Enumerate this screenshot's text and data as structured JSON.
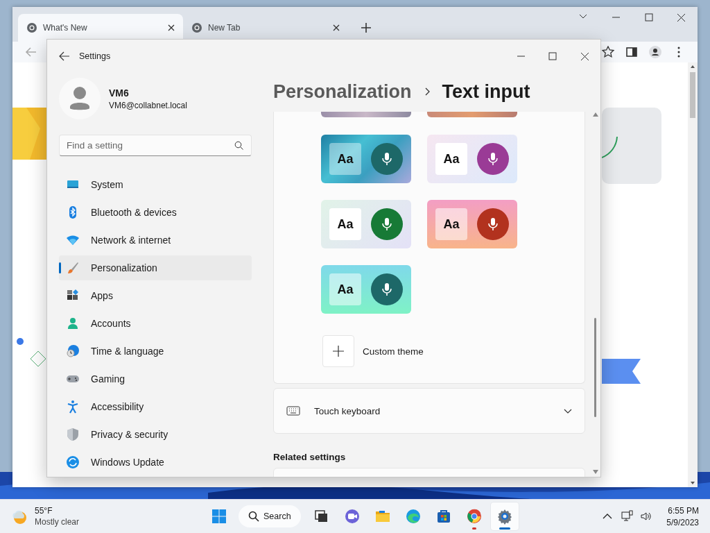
{
  "browser": {
    "tabs": [
      {
        "title": "What's New",
        "selected": true
      },
      {
        "title": "New Tab",
        "selected": false
      }
    ]
  },
  "settings": {
    "window_title": "Settings",
    "account": {
      "name": "VM6",
      "email": "VM6@collabnet.local"
    },
    "search": {
      "placeholder": "Find a setting"
    },
    "nav": [
      {
        "label": "System",
        "selected": false
      },
      {
        "label": "Bluetooth & devices",
        "selected": false
      },
      {
        "label": "Network & internet",
        "selected": false
      },
      {
        "label": "Personalization",
        "selected": true
      },
      {
        "label": "Apps",
        "selected": false
      },
      {
        "label": "Accounts",
        "selected": false
      },
      {
        "label": "Time & language",
        "selected": false
      },
      {
        "label": "Gaming",
        "selected": false
      },
      {
        "label": "Accessibility",
        "selected": false
      },
      {
        "label": "Privacy & security",
        "selected": false
      },
      {
        "label": "Windows Update",
        "selected": false
      }
    ],
    "breadcrumb": {
      "parent": "Personalization",
      "current": "Text input"
    },
    "themes": [
      {
        "text": "Aa",
        "color": "#1d6868"
      },
      {
        "text": "Aa",
        "color": "#9a3b96"
      },
      {
        "text": "Aa",
        "color": "#177a36"
      },
      {
        "text": "Aa",
        "color": "#b2321e"
      },
      {
        "text": "Aa",
        "color": "#1d6868"
      }
    ],
    "custom_theme": "Custom theme",
    "touch_keyboard": {
      "label": "Touch keyboard",
      "expanded": false
    },
    "related_settings": "Related settings"
  },
  "taskbar": {
    "weather": {
      "temperature": "55°F",
      "condition": "Mostly clear"
    },
    "search_label": "Search",
    "apps": [
      {
        "running": false,
        "selected": false
      },
      {
        "running": false,
        "selected": false
      },
      {
        "running": false,
        "selected": false
      },
      {
        "running": false,
        "selected": false
      },
      {
        "running": false,
        "selected": false
      },
      {
        "running": true,
        "selected": false
      },
      {
        "running": true,
        "selected": true
      }
    ],
    "clock": {
      "time": "6:55 PM",
      "date": "5/9/2023"
    }
  }
}
